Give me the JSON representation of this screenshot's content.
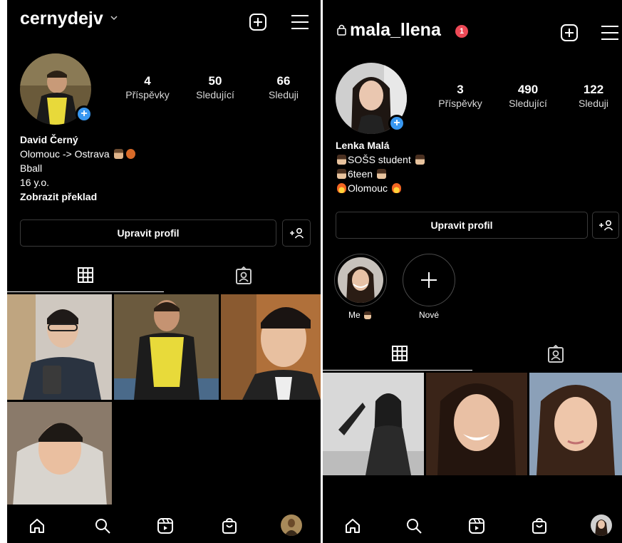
{
  "left": {
    "username": "cernydejv",
    "stats": [
      {
        "value": "4",
        "label": "Příspěvky"
      },
      {
        "value": "50",
        "label": "Sledující"
      },
      {
        "value": "66",
        "label": "Sleduji"
      }
    ],
    "bio": {
      "name": "David Černý",
      "line1": "Olomouc -> Ostrava",
      "line2": "Bball",
      "line3": "16 y.o.",
      "translate": "Zobrazit překlad"
    },
    "edit_profile": "Upravit profil",
    "icons": {
      "new_post": "plus-square-icon",
      "menu": "hamburger-menu-icon",
      "grid": "grid-icon",
      "tagged": "tagged-person-icon",
      "add_friend": "add-person-icon"
    }
  },
  "right": {
    "username": "mala_llena",
    "notification_count": "1",
    "stats": [
      {
        "value": "3",
        "label": "Příspěvky"
      },
      {
        "value": "490",
        "label": "Sledující"
      },
      {
        "value": "122",
        "label": "Sleduji"
      }
    ],
    "bio": {
      "name": "Lenka Malá",
      "line1": "SOŠS student",
      "line2": "6teen",
      "line3": "Olomouc"
    },
    "edit_profile": "Upravit profil",
    "highlights": [
      {
        "label": "Me"
      },
      {
        "label": "Nové"
      }
    ],
    "icons": {
      "lock": "lock-icon",
      "new_post": "plus-square-icon",
      "menu": "hamburger-menu-icon",
      "grid": "grid-icon",
      "tagged": "tagged-person-icon",
      "add_friend": "add-person-icon"
    }
  },
  "bottom_nav": [
    "home-icon",
    "search-icon",
    "reels-icon",
    "shop-icon",
    "profile-avatar"
  ],
  "colors": {
    "background": "#000000",
    "accent_blue": "#3897f0",
    "notification_red": "#ed4956",
    "border": "#3a3a3a"
  }
}
